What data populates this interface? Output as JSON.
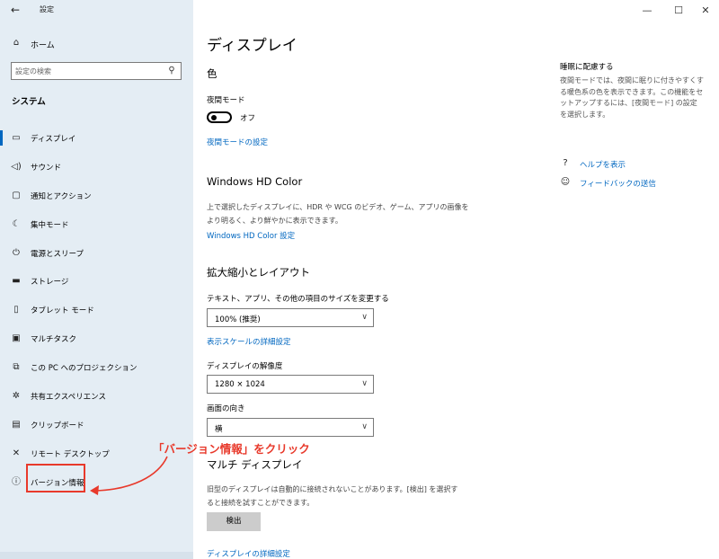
{
  "window": {
    "title": "設定",
    "back_icon": "back-arrow-icon",
    "minimize": "—",
    "maximize": "☐",
    "close": "✕"
  },
  "sidebar": {
    "home_label": "ホーム",
    "search_placeholder": "設定の検索",
    "section_title": "システム",
    "items": [
      {
        "label": "ディスプレイ",
        "icon": "monitor-icon"
      },
      {
        "label": "サウンド",
        "icon": "speaker-icon"
      },
      {
        "label": "通知とアクション",
        "icon": "notification-icon"
      },
      {
        "label": "集中モード",
        "icon": "moon-icon"
      },
      {
        "label": "電源とスリープ",
        "icon": "power-icon"
      },
      {
        "label": "ストレージ",
        "icon": "storage-icon"
      },
      {
        "label": "タブレット モード",
        "icon": "tablet-icon"
      },
      {
        "label": "マルチタスク",
        "icon": "multitask-icon"
      },
      {
        "label": "この PC へのプロジェクション",
        "icon": "projection-icon"
      },
      {
        "label": "共有エクスペリエンス",
        "icon": "share-icon"
      },
      {
        "label": "クリップボード",
        "icon": "clipboard-icon"
      },
      {
        "label": "リモート デスクトップ",
        "icon": "remote-icon"
      },
      {
        "label": "バージョン情報",
        "icon": "info-icon"
      }
    ],
    "selected": "ディスプレイ"
  },
  "annotation": {
    "text": "「バージョン情報」をクリック",
    "color": "#e8392b"
  },
  "main": {
    "title": "ディスプレイ",
    "color_heading": "色",
    "night_mode_label": "夜間モード",
    "night_mode_state": "オフ",
    "night_mode_link": "夜間モードの設定",
    "hdr_heading": "Windows HD Color",
    "hdr_desc": "上で選択したディスプレイに、HDR や WCG のビデオ、ゲーム、アプリの画像を\nより明るく、より鮮やかに表示できます。",
    "hdr_link": "Windows HD Color 設定",
    "scale_heading": "拡大縮小とレイアウト",
    "scale_label": "テキスト、アプリ、その他の項目のサイズを変更する",
    "scale_value": "100% (推奨)",
    "scale_link": "表示スケールの詳細設定",
    "resolution_label": "ディスプレイの解像度",
    "resolution_value": "1280 × 1024",
    "orientation_label": "画面の向き",
    "orientation_value": "横",
    "multi_heading": "マルチ ディスプレイ",
    "multi_desc": "旧型のディスプレイは自動的に接続されないことがあります。[検出] を選択す\nると接続を試すことができます。",
    "detect_button": "検出",
    "advanced_link": "ディスプレイの詳細設定"
  },
  "right": {
    "title": "睡眠に配慮する",
    "desc": "夜間モードでは、夜間に眠りに付きやすくする暖色系の色を表示できます。この機能をセットアップするには、[夜間モード] の設定を選択します。",
    "help_link": "ヘルプを表示",
    "feedback_link": "フィードバックの送信"
  },
  "accent_color": "#0067c0"
}
